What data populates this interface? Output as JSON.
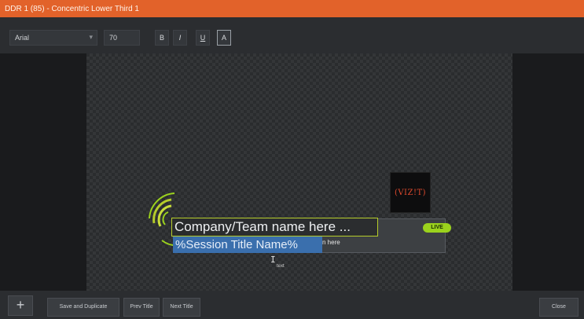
{
  "window": {
    "title": "DDR 1 (85) - Concentric Lower Third 1"
  },
  "toolbar": {
    "font_family": "Arial",
    "font_size": "70",
    "bold_label": "B",
    "italic_label": "I",
    "underline_label": "U",
    "outline_label": "A"
  },
  "canvas": {
    "logo_text": "(VIZ!T)",
    "company_text": "Company/Team name here ...",
    "live_badge": "LIVE",
    "session_text": "%Session Title Name%",
    "subtitle_text": "n here",
    "cursor_label": "text"
  },
  "bottombar": {
    "add_label": "+",
    "save_duplicate_label": "Save and Duplicate",
    "prev_title_label": "Prev Title",
    "next_title_label": "Next Title",
    "close_label": "Close"
  },
  "colors": {
    "titlebar": "#e2622a",
    "accent_green": "#b5cc2a",
    "live_green": "#9bd21d",
    "selection_blue": "#3a6fad"
  }
}
